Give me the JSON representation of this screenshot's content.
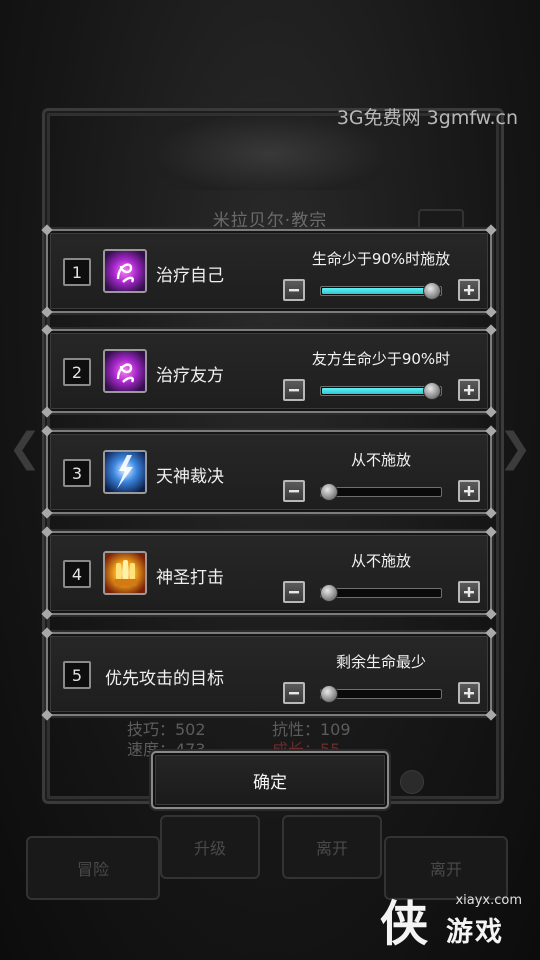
{
  "watermark": {
    "top_text": "3G免费网  3gmfw.cn",
    "site": "xiayx.com",
    "glyph": "侠",
    "name": "游戏"
  },
  "background": {
    "title": "米拉贝尔·教宗",
    "stat_left_1": "技巧：502",
    "stat_left_2": "速度：473",
    "stat_right_1": "抗性：109",
    "stat_right_2": "成长：55",
    "btn_upgrade": "升级",
    "btn_leave": "离开",
    "btn_adventure": "冒险",
    "btn_leave_far": "离开"
  },
  "colors": {
    "slider_fill": "#2fc8d2",
    "panel_border": "#7c7c7c",
    "text": "#f0f0f0"
  },
  "rows": [
    {
      "num": "1",
      "icon": "purple-heal-icon",
      "name": "治疗自己",
      "condition": "生命少于90%时施放",
      "level": 1.0
    },
    {
      "num": "2",
      "icon": "purple-heal-icon",
      "name": "治疗友方",
      "condition": "友方生命少于90%时",
      "level": 1.0
    },
    {
      "num": "3",
      "icon": "blue-lightning-icon",
      "name": "天神裁决",
      "condition": "从不施放",
      "level": 0.0
    },
    {
      "num": "4",
      "icon": "golden-holy-strike-icon",
      "name": "神圣打击",
      "condition": "从不施放",
      "level": 0.0
    },
    {
      "num": "5",
      "icon": "",
      "name": "优先攻击的目标",
      "condition": "剩余生命最少",
      "level": 0.0
    }
  ],
  "confirm_label": "确定"
}
